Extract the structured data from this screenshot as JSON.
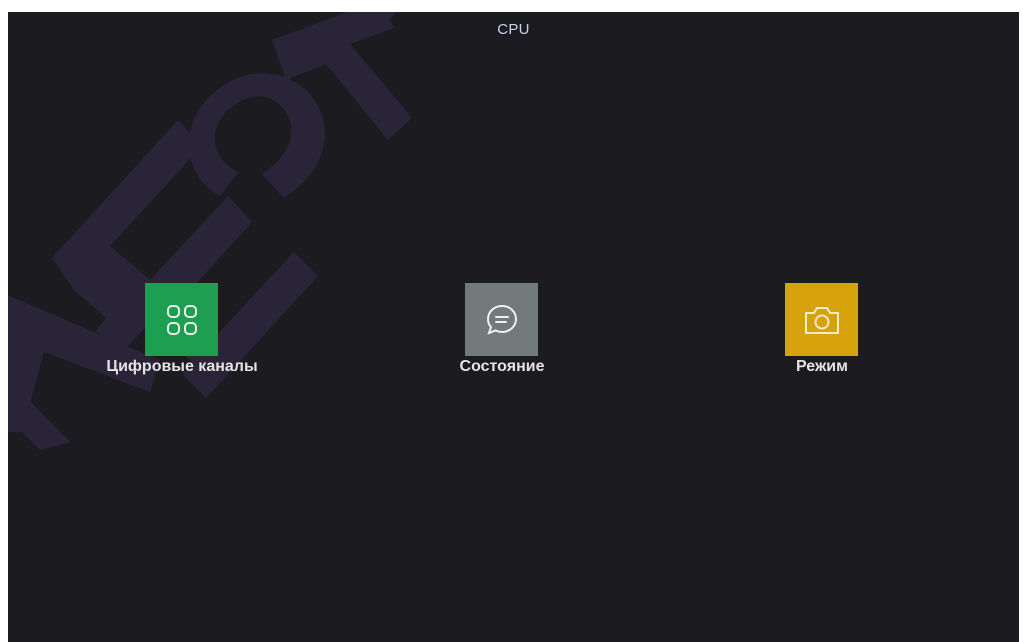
{
  "screen": {
    "title": "CPU",
    "watermark_text": "Amate"
  },
  "tiles": [
    {
      "label": "Цифровые каналы",
      "icon": "grid-icon",
      "color": "#1e9e50"
    },
    {
      "label": "Состояние",
      "icon": "chat-bubble-icon",
      "color": "#737a7a"
    },
    {
      "label": "Режим",
      "icon": "camera-icon",
      "color": "#d6a20c"
    }
  ],
  "colors": {
    "background": "#1c1b20",
    "title": "#c8d2f0",
    "watermark": "#2a2438"
  }
}
